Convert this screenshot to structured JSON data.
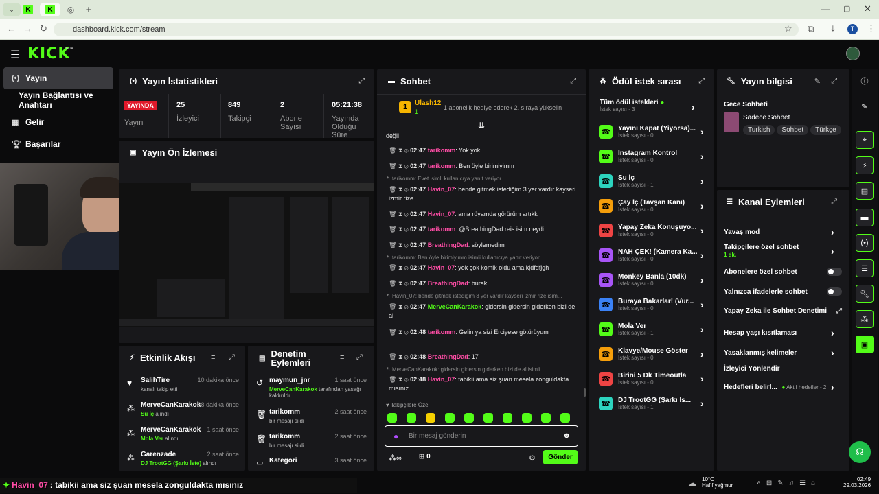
{
  "browser": {
    "url": "dashboard.kick.com/stream",
    "tab_icon": "K",
    "new_tab": "+",
    "profile": "T"
  },
  "header": {
    "logo": "KICK",
    "logo_beta": "BETA"
  },
  "sidebar": {
    "items": [
      {
        "label": "Yayın",
        "icon": "broadcast-icon"
      },
      {
        "label": "Yayın Bağlantısı ve Anahtarı",
        "icon": ""
      },
      {
        "label": "Gelir",
        "icon": "revenue-icon"
      },
      {
        "label": "Başarılar",
        "icon": "trophy-icon"
      }
    ]
  },
  "stats": {
    "title": "Yayın İstatistikleri",
    "live_badge": "YAYINDA",
    "live_label": "Yayın",
    "cols": [
      {
        "value": "25",
        "label": "İzleyici"
      },
      {
        "value": "849",
        "label": "Takipçi"
      },
      {
        "value": "2",
        "label": "Abone Sayısı"
      },
      {
        "value": "05:21:38",
        "label": "Yayında Olduğu Süre"
      }
    ]
  },
  "preview": {
    "title": "Yayın Ön İzlemesi"
  },
  "activity": {
    "title": "Etkinlik Akışı",
    "items": [
      {
        "name": "SalihTire",
        "time": "10 dakika önce",
        "sub": "kanalı takip etti"
      },
      {
        "name": "MerveCanKarakok",
        "time": "38 dakika önce",
        "sub_green": "Su İç",
        "sub": "alındı"
      },
      {
        "name": "MerveCanKarakok",
        "time": "1 saat önce",
        "sub_green": "Mola Ver",
        "sub": "alındı"
      },
      {
        "name": "Garenzade",
        "time": "2 saat önce",
        "sub_green": "DJ TrootGG (Şarkı İste)",
        "sub": "alındı"
      }
    ]
  },
  "moderation": {
    "title": "Denetim Eylemleri",
    "items": [
      {
        "name": "maymun_jnr",
        "time": "1 saat önce",
        "sub_green": "MerveCanKarakok",
        "sub": "tarafından yasağı kaldırıldı"
      },
      {
        "name": "tarikomm",
        "time": "2 saat önce",
        "sub": "bir mesajı sildi"
      },
      {
        "name": "tarikomm",
        "time": "2 saat önce",
        "sub": "bir mesajı sildi"
      },
      {
        "name": "Kategori",
        "time": "3 saat önce",
        "sub": ""
      }
    ]
  },
  "chat": {
    "title": "Sohbet",
    "pinned_user": "Ulash12",
    "pinned_count": "1",
    "pinned_text": "1 abonelik hediye ederek 2. sıraya yükselin",
    "first_line": "değil",
    "lines": [
      {
        "time": "02:47",
        "name": "tarikomm",
        "color": "#ff4da6",
        "msg": ": Yok yok"
      },
      {
        "time": "02:47",
        "name": "tarikomm",
        "color": "#ff4da6",
        "msg": ": Ben öyle birimiyimm"
      },
      {
        "reply": "tarikomm: Evet isimli kullanıcıya yanıt veriyor"
      },
      {
        "time": "02:47",
        "name": "Havin_07",
        "color": "#ff4da6",
        "msg": ": bende gitmek istediğim 3 yer vardır kayseri izmir rize"
      },
      {
        "time": "02:47",
        "name": "Havin_07",
        "color": "#ff4da6",
        "msg": ": ama rüyamda görürüm artıkk"
      },
      {
        "time": "02:47",
        "name": "tarikomm",
        "color": "#ff4da6",
        "msg": ": @BreathingDad reis isim neydi"
      },
      {
        "time": "02:47",
        "name": "BreathingDad",
        "color": "#ff4da6",
        "msg": ": söylemedim"
      },
      {
        "reply": "tarikomm: Ben öyle birimiyimm isimli kullanıcıya yanıt veriyor"
      },
      {
        "time": "02:47",
        "name": "Havin_07",
        "color": "#ff4da6",
        "msg": ": yok çok komik oldu ama kjdfdfjgh"
      },
      {
        "time": "02:47",
        "name": "BreathingDad",
        "color": "#ff4da6",
        "msg": ": burak"
      },
      {
        "reply": "Havin_07: bende gitmek istediğim 3 yer vardır kayseri izmir rize isim..."
      },
      {
        "time": "02:47",
        "name": "MerveCanKarakok",
        "color": "#53fc18",
        "msg": ": gidersin gidersin giderken bizi de al"
      },
      {
        "time": "02:48",
        "name": "tarikomm",
        "color": "#ff4da6",
        "msg": ": Gelin ya sizi Erciyese götürüyum"
      },
      {
        "time": "02:48",
        "name": "BreathingDad",
        "color": "#ff4da6",
        "msg": ": 17"
      },
      {
        "reply": "MerveCanKarakok: gidersin gidersin giderken bizi de al isimli ..."
      },
      {
        "time": "02:48",
        "name": "Havin_07",
        "color": "#ff4da6",
        "msg": ": tabikii ama siz şuan mesela zonguldakta mısınız"
      }
    ],
    "emote_label": "Takipçilere Özel",
    "input_placeholder": "Bir mesaj gönderin",
    "count": "0",
    "send": "Gönder"
  },
  "rewards": {
    "title": "Ödül istek sırası",
    "all": "Tüm ödül istekleri",
    "all_sub": "İstek sayısı - 3",
    "items": [
      {
        "name": "Yayını Kapat (Yiyorsa)...",
        "sub": "İstek sayısı - 0",
        "color": "#53fc18"
      },
      {
        "name": "Instagram Kontrol",
        "sub": "İstek sayısı - 0",
        "color": "#53fc18"
      },
      {
        "name": "Su İç",
        "sub": "İstek sayısı - 1",
        "color": "#2dd4bf"
      },
      {
        "name": "Çay İç (Tavşan Kanı)",
        "sub": "İstek sayısı - 0",
        "color": "#f59e0b"
      },
      {
        "name": "Yapay Zeka Konuşuyo...",
        "sub": "İstek sayısı - 0",
        "color": "#ef4444"
      },
      {
        "name": "NAH ÇEK! (Kamera Ka...",
        "sub": "İstek sayısı - 0",
        "color": "#a855f7"
      },
      {
        "name": "Monkey Banla (10dk)",
        "sub": "İstek sayısı - 0",
        "color": "#a855f7"
      },
      {
        "name": "Buraya Bakarlar! (Vur...",
        "sub": "İstek sayısı - 0",
        "color": "#3b82f6"
      },
      {
        "name": "Mola Ver",
        "sub": "İstek sayısı - 1",
        "color": "#53fc18"
      },
      {
        "name": "Klavye/Mouse Göster",
        "sub": "İstek sayısı - 0",
        "color": "#f59e0b"
      },
      {
        "name": "Birini 5 Dk Timeoutla",
        "sub": "İstek sayısı - 0",
        "color": "#ef4444"
      },
      {
        "name": "DJ TrootGG (Şarkı İs...",
        "sub": "İstek sayısı - 1",
        "color": "#2dd4bf"
      }
    ]
  },
  "info": {
    "title": "Yayın bilgisi",
    "stream_title": "Gece Sohbeti",
    "category": "Sadece Sohbet",
    "tags": [
      "Turkish",
      "Sohbet",
      "Türkçe"
    ]
  },
  "channel": {
    "title": "Kanal Eylemleri",
    "items": [
      {
        "label": "Yavaş mod",
        "type": "chev"
      },
      {
        "label": "Takipçilere özel sohbet",
        "sub": "1 dk.",
        "type": "chev"
      },
      {
        "label": "Abonelere özel sohbet",
        "type": "toggle"
      },
      {
        "label": "Yalnızca ifadelerle sohbet",
        "type": "toggle"
      },
      {
        "label": "Yapay Zeka ile Sohbet Denetimi",
        "type": "ext"
      },
      {
        "label": "Hesap yaşı kısıtlaması",
        "type": "chev"
      },
      {
        "label": "Yasaklanmış kelimeler",
        "type": "chev"
      },
      {
        "label": "İzleyici Yönlendir",
        "type": "none"
      },
      {
        "label": "Hedefleri belirl...",
        "extra": "Aktif hedefler - 2",
        "type": "chev"
      }
    ]
  },
  "subtitle": {
    "name": "Havin_07",
    "text": ": tabikii ama siz şuan mesela zonguldakta mısınız"
  },
  "taskbar": {
    "weather_temp": "10°C",
    "weather_desc": "Hafif yağmur",
    "time": "02:49",
    "date": "29.03.2026"
  }
}
